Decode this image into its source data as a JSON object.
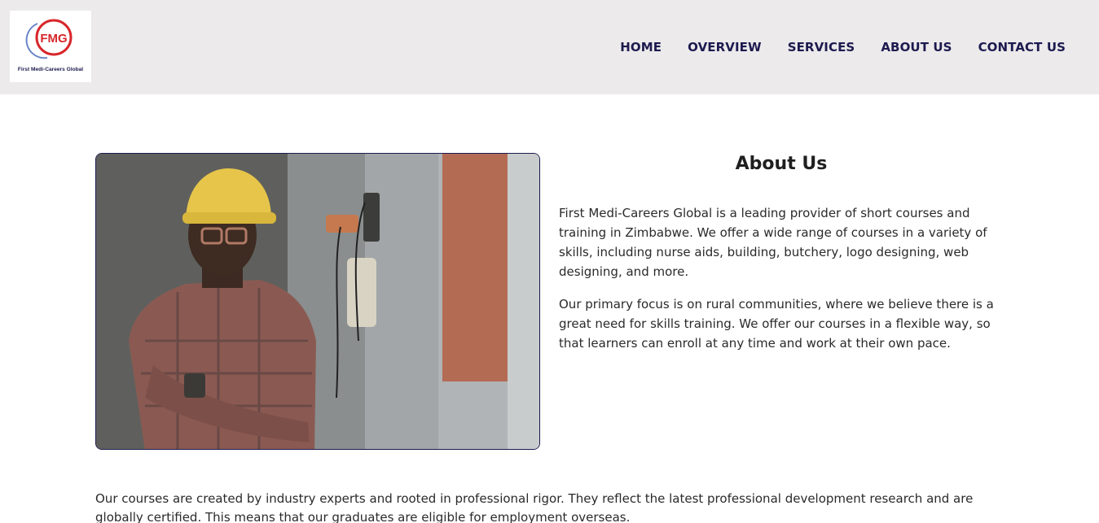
{
  "header": {
    "logo": {
      "monogram": "FMG",
      "tagline": "First Medi-Careers Global"
    },
    "nav": [
      {
        "label": "HOME"
      },
      {
        "label": "OVERVIEW"
      },
      {
        "label": "SERVICES"
      },
      {
        "label": "ABOUT US"
      },
      {
        "label": "CONTACT US"
      }
    ]
  },
  "about": {
    "title": "About Us",
    "paragraph1": "First Medi-Careers Global is a leading provider of short courses and training in Zimbabwe. We offer a wide range of courses in a variety of skills, including nurse aids, building, butchery, logo designing, web designing, and more.",
    "paragraph2": "Our primary focus is on rural communities, where we believe there is a great need for skills training. We offer our courses in a flexible way, so that learners can enroll at any time and work at their own pace.",
    "paragraph3": "Our courses are created by industry experts and rooted in professional rigor. They reflect the latest professional development research and are globally certified. This means that our graduates are eligible for employment overseas."
  },
  "colors": {
    "header_bg": "#eceaeb",
    "nav_text": "#1c1a4e",
    "logo_red": "#d7262b",
    "logo_blue": "#1f3b8f"
  }
}
